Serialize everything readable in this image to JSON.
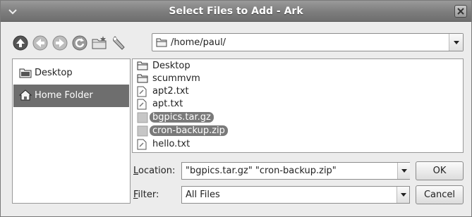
{
  "window": {
    "title": "Select Files to Add - Ark"
  },
  "toolbar": {
    "buttons": [
      {
        "name": "up-icon"
      },
      {
        "name": "back-icon"
      },
      {
        "name": "forward-icon"
      },
      {
        "name": "reload-icon"
      },
      {
        "name": "new-folder-icon"
      },
      {
        "name": "options-icon"
      }
    ],
    "location_path": "/home/paul/"
  },
  "places": [
    {
      "label": "Desktop",
      "icon": "desktop-icon",
      "selected": false
    },
    {
      "label": "Home Folder",
      "icon": "home-icon",
      "selected": true
    }
  ],
  "files": [
    {
      "name": "Desktop",
      "type": "folder",
      "selected": false
    },
    {
      "name": "scummvm",
      "type": "folder",
      "selected": false
    },
    {
      "name": "apt2.txt",
      "type": "text",
      "selected": false
    },
    {
      "name": "apt.txt",
      "type": "text",
      "selected": false
    },
    {
      "name": "bgpics.tar.gz",
      "type": "archive",
      "selected": true
    },
    {
      "name": "cron-backup.zip",
      "type": "archive",
      "selected": true
    },
    {
      "name": "hello.txt",
      "type": "text",
      "selected": false
    }
  ],
  "location_field": {
    "label_accel": "L",
    "label_rest": "ocation:",
    "value": "\"bgpics.tar.gz\" \"cron-backup.zip\""
  },
  "filter_field": {
    "label_accel": "F",
    "label_rest": "ilter:",
    "value": "All Files"
  },
  "buttons": {
    "ok": "OK",
    "cancel": "Cancel"
  }
}
